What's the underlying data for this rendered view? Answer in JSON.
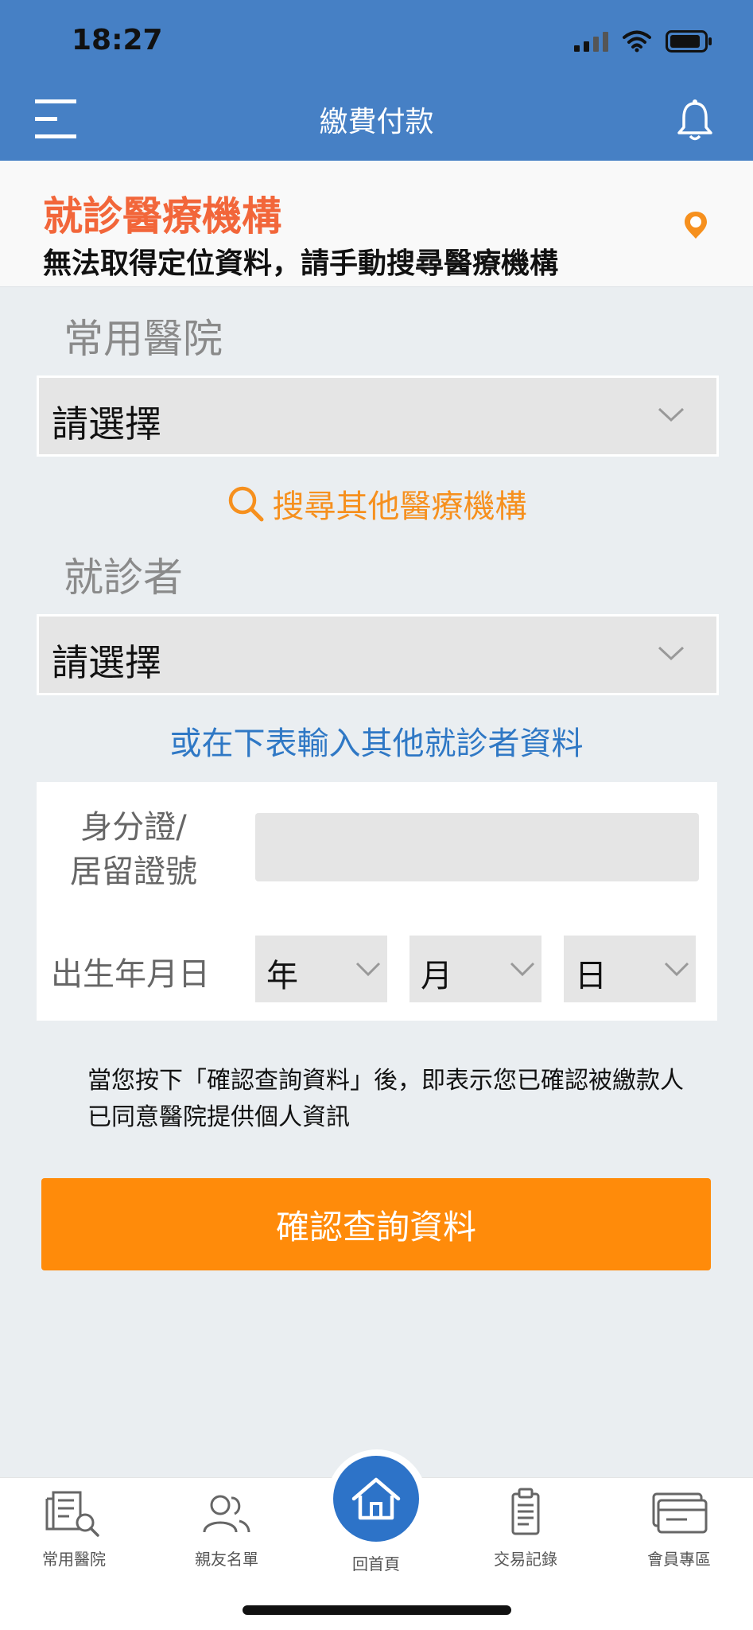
{
  "status_bar": {
    "time": "18:27"
  },
  "nav": {
    "title": "繳費付款"
  },
  "location": {
    "title": "就診醫療機構",
    "message": "無法取得定位資料，請手動搜尋醫療機構"
  },
  "hospital": {
    "label": "常用醫院",
    "select_value": "請選擇",
    "search_link": "搜尋其他醫療機構"
  },
  "patient": {
    "label": "就診者",
    "select_value": "請選擇",
    "other_link": "或在下表輸入其他就診者資料"
  },
  "form": {
    "id_label_line1": "身分證/",
    "id_label_line2": "居留證號",
    "id_value": "",
    "dob_label": "出生年月日",
    "year": "年",
    "month": "月",
    "day": "日"
  },
  "notice": "當您按下「確認查詢資料」後，即表示您已確認被繳款人已同意醫院提供個人資訊",
  "confirm_button": "確認查詢資料",
  "tabs": [
    {
      "label": "常用醫院",
      "icon": "hospital-list-icon"
    },
    {
      "label": "親友名單",
      "icon": "friends-icon"
    },
    {
      "label": "回首頁",
      "icon": "home-icon"
    },
    {
      "label": "交易記錄",
      "icon": "receipt-icon"
    },
    {
      "label": "會員專區",
      "icon": "member-card-icon"
    }
  ],
  "colors": {
    "header": "#4680c5",
    "accent_orange": "#ff8b0a",
    "title_red": "#f2663a",
    "link_blue": "#2f78c5",
    "home_blue": "#2d73c8"
  }
}
